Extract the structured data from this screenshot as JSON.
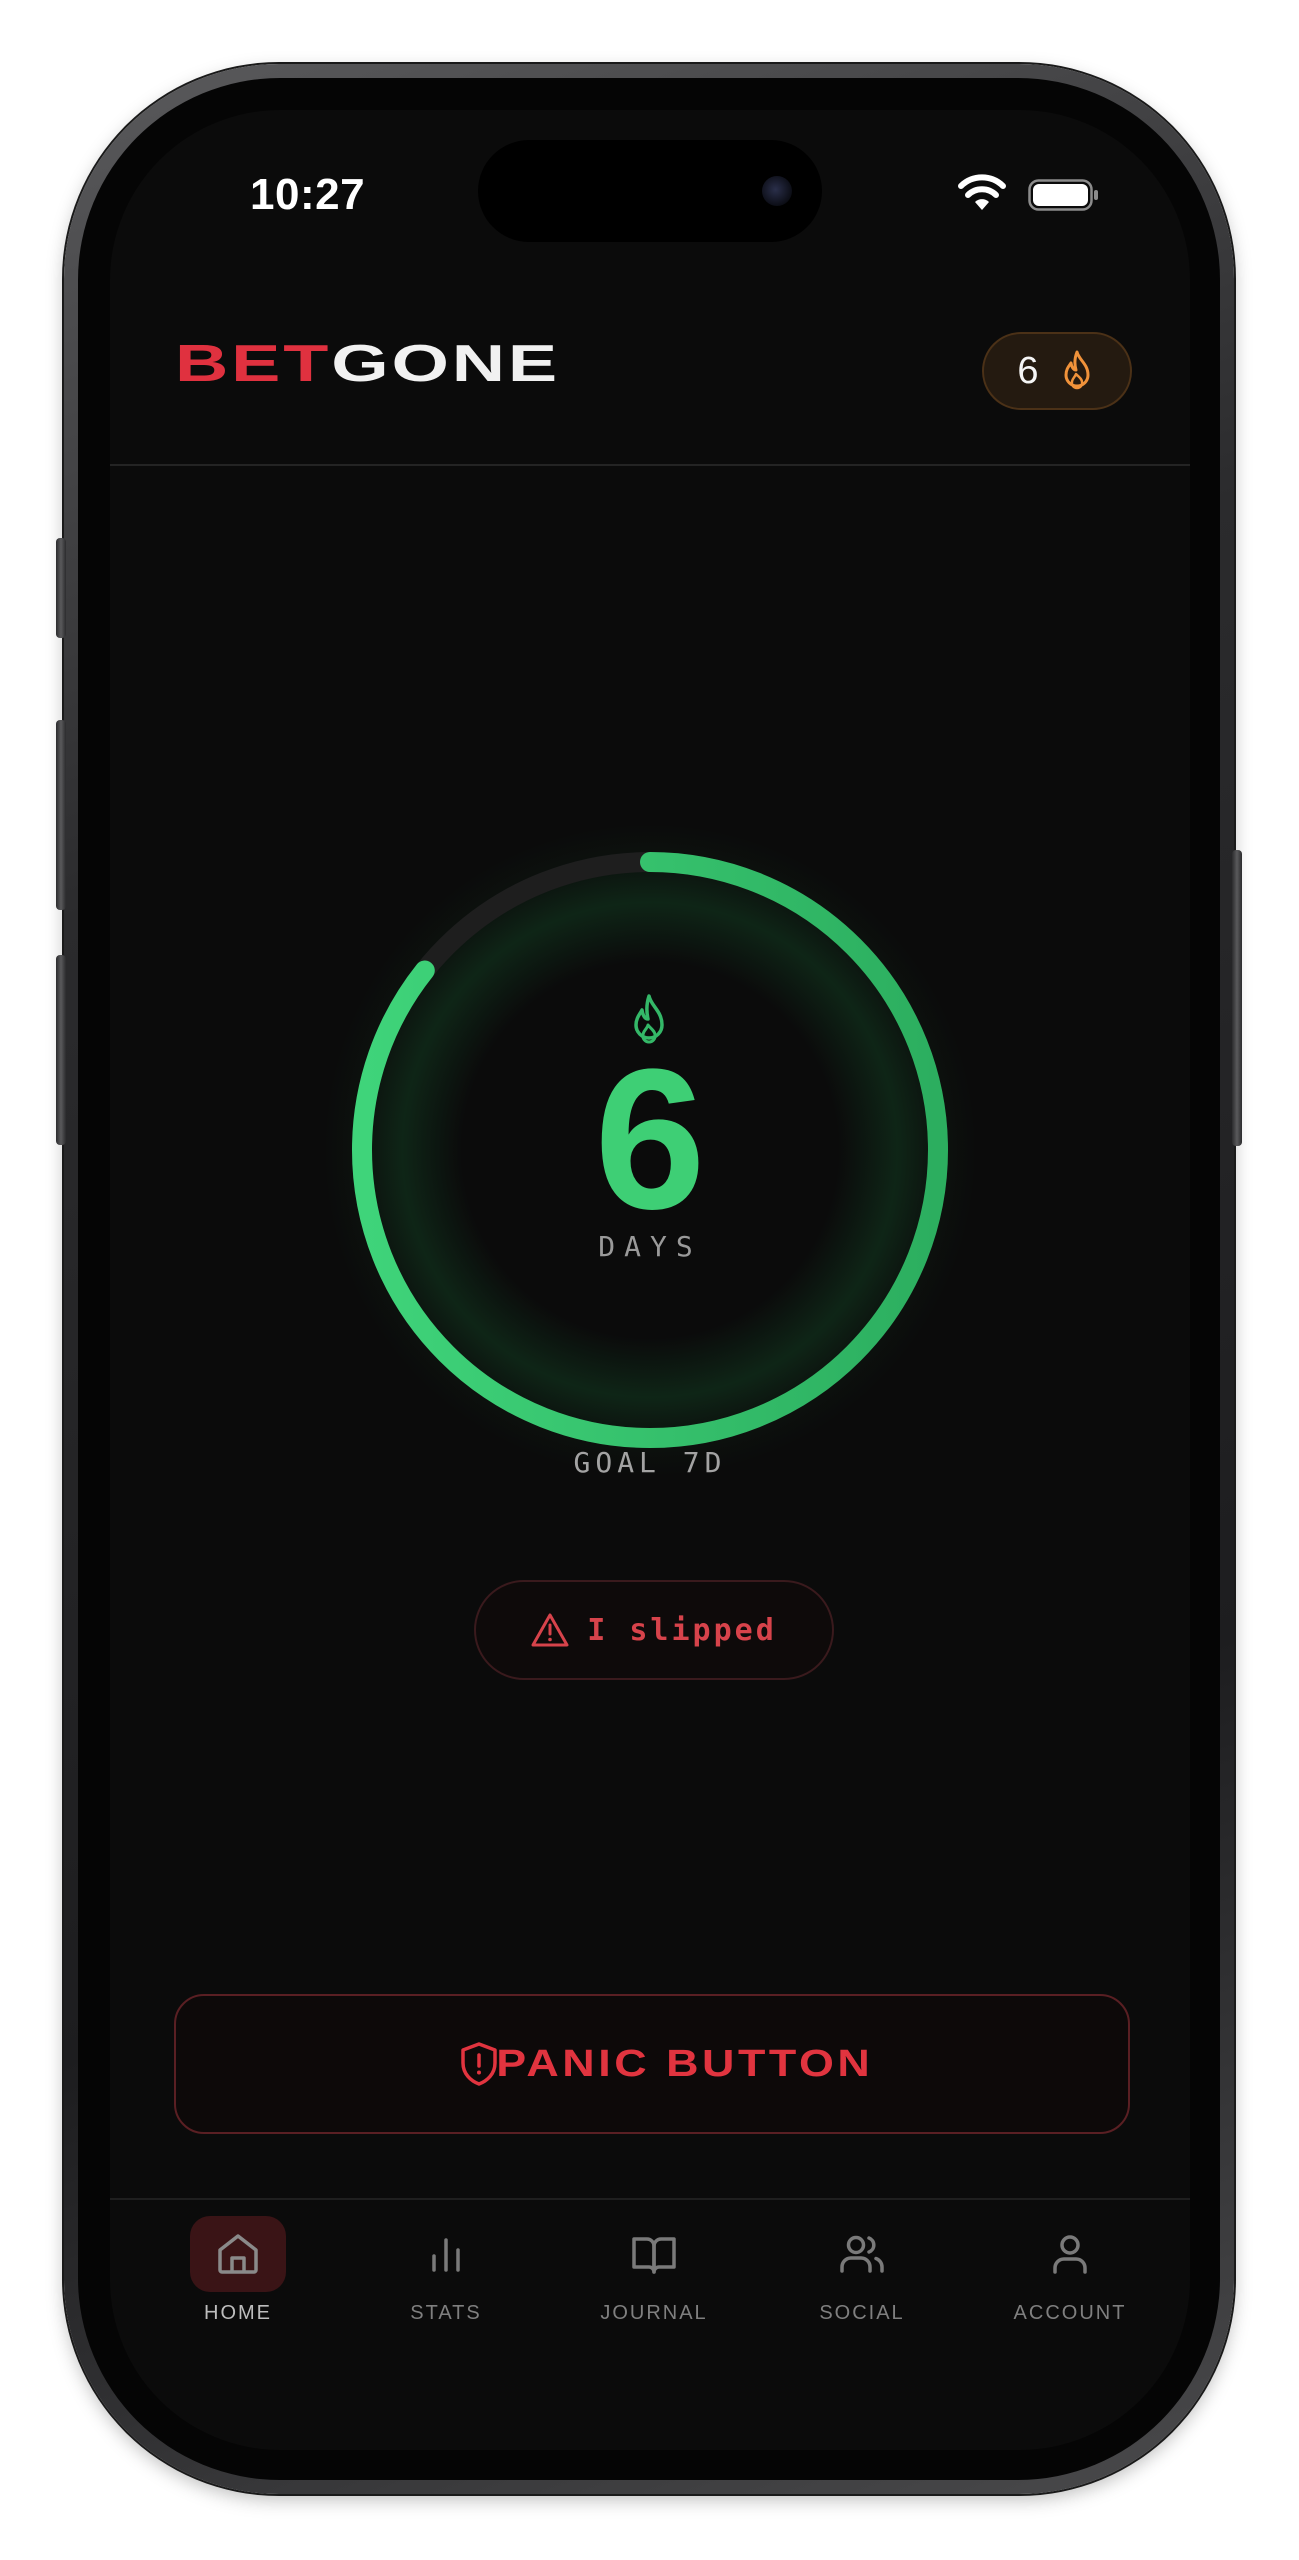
{
  "status_bar": {
    "time": "10:27"
  },
  "header": {
    "logo_part1": "BET",
    "logo_part2": "GONE",
    "streak_count": "6",
    "streak_icon": "flame-icon"
  },
  "streak": {
    "value": "6",
    "unit": "DAYS",
    "goal_label": "GOAL 7D",
    "current_days": 6,
    "goal_days": 7,
    "progress_fraction": 0.857
  },
  "actions": {
    "slip_label": "I slipped",
    "slip_icon": "warning-triangle-icon",
    "panic_label": "PANIC BUTTON",
    "panic_icon": "shield-alert-icon"
  },
  "tabs": [
    {
      "label": "HOME",
      "icon": "home-icon",
      "active": true
    },
    {
      "label": "STATS",
      "icon": "bar-chart-icon",
      "active": false
    },
    {
      "label": "JOURNAL",
      "icon": "book-open-icon",
      "active": false
    },
    {
      "label": "SOCIAL",
      "icon": "users-icon",
      "active": false
    },
    {
      "label": "ACCOUNT",
      "icon": "user-icon",
      "active": false
    }
  ],
  "colors": {
    "brand_red": "#e0313f",
    "accent_green": "#3ecf75",
    "streak_orange": "#f0923a",
    "background": "#0b0b0b"
  }
}
